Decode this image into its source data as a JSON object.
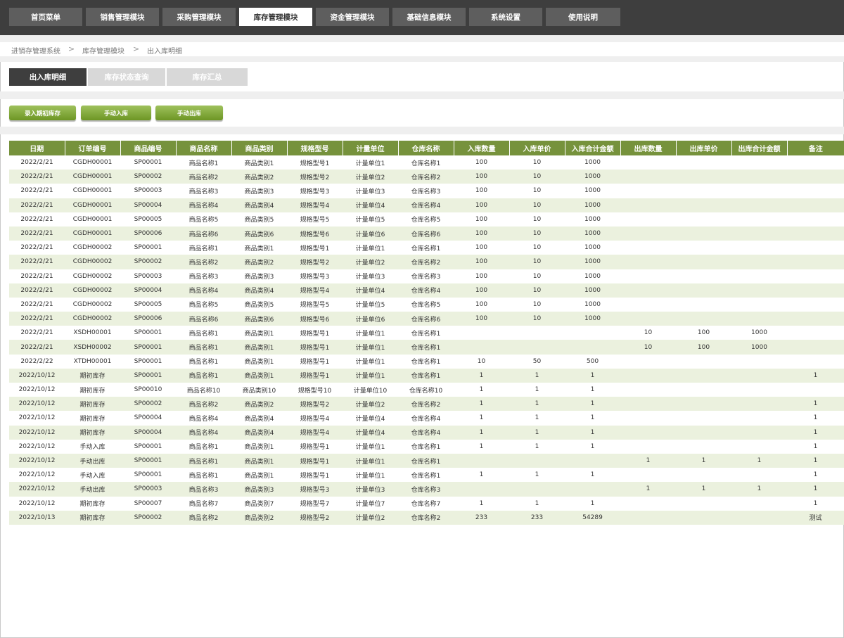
{
  "nav": {
    "tabs": [
      {
        "label": "首页菜单",
        "active": false
      },
      {
        "label": "销售管理模块",
        "active": false
      },
      {
        "label": "采购管理模块",
        "active": false
      },
      {
        "label": "库存管理模块",
        "active": true
      },
      {
        "label": "资金管理模块",
        "active": false
      },
      {
        "label": "基础信息模块",
        "active": false
      },
      {
        "label": "系统设置",
        "active": false
      },
      {
        "label": "使用说明",
        "active": false
      }
    ]
  },
  "breadcrumb": {
    "items": [
      "进销存管理系统",
      "库存管理模块",
      "出入库明细"
    ],
    "separator": ">"
  },
  "subtabs": [
    {
      "label": "出入库明细",
      "active": true
    },
    {
      "label": "库存状态查询",
      "active": false
    },
    {
      "label": "库存汇总",
      "active": false
    }
  ],
  "actions": [
    "录入期初库存",
    "手动入库",
    "手动出库"
  ],
  "colors": {
    "topbar": "#3e3e3e",
    "nav_tab": "#5e5e5e",
    "header_green": "#76923c",
    "row_alt": "#ebf1de",
    "button_green": "#7ca233"
  },
  "table": {
    "columns": [
      "日期",
      "订单编号",
      "商品编号",
      "商品名称",
      "商品类别",
      "规格型号",
      "计量单位",
      "仓库名称",
      "入库数量",
      "入库单价",
      "入库合计金额",
      "出库数量",
      "出库单价",
      "出库合计金额",
      "备注"
    ],
    "rows": [
      [
        "2022/2/21",
        "CGDH00001",
        "SP00001",
        "商品名称1",
        "商品类别1",
        "规格型号1",
        "计量单位1",
        "仓库名称1",
        "100",
        "10",
        "1000",
        "",
        "",
        "",
        ""
      ],
      [
        "2022/2/21",
        "CGDH00001",
        "SP00002",
        "商品名称2",
        "商品类别2",
        "规格型号2",
        "计量单位2",
        "仓库名称2",
        "100",
        "10",
        "1000",
        "",
        "",
        "",
        ""
      ],
      [
        "2022/2/21",
        "CGDH00001",
        "SP00003",
        "商品名称3",
        "商品类别3",
        "规格型号3",
        "计量单位3",
        "仓库名称3",
        "100",
        "10",
        "1000",
        "",
        "",
        "",
        ""
      ],
      [
        "2022/2/21",
        "CGDH00001",
        "SP00004",
        "商品名称4",
        "商品类别4",
        "规格型号4",
        "计量单位4",
        "仓库名称4",
        "100",
        "10",
        "1000",
        "",
        "",
        "",
        ""
      ],
      [
        "2022/2/21",
        "CGDH00001",
        "SP00005",
        "商品名称5",
        "商品类别5",
        "规格型号5",
        "计量单位5",
        "仓库名称5",
        "100",
        "10",
        "1000",
        "",
        "",
        "",
        ""
      ],
      [
        "2022/2/21",
        "CGDH00001",
        "SP00006",
        "商品名称6",
        "商品类别6",
        "规格型号6",
        "计量单位6",
        "仓库名称6",
        "100",
        "10",
        "1000",
        "",
        "",
        "",
        ""
      ],
      [
        "2022/2/21",
        "CGDH00002",
        "SP00001",
        "商品名称1",
        "商品类别1",
        "规格型号1",
        "计量单位1",
        "仓库名称1",
        "100",
        "10",
        "1000",
        "",
        "",
        "",
        ""
      ],
      [
        "2022/2/21",
        "CGDH00002",
        "SP00002",
        "商品名称2",
        "商品类别2",
        "规格型号2",
        "计量单位2",
        "仓库名称2",
        "100",
        "10",
        "1000",
        "",
        "",
        "",
        ""
      ],
      [
        "2022/2/21",
        "CGDH00002",
        "SP00003",
        "商品名称3",
        "商品类别3",
        "规格型号3",
        "计量单位3",
        "仓库名称3",
        "100",
        "10",
        "1000",
        "",
        "",
        "",
        ""
      ],
      [
        "2022/2/21",
        "CGDH00002",
        "SP00004",
        "商品名称4",
        "商品类别4",
        "规格型号4",
        "计量单位4",
        "仓库名称4",
        "100",
        "10",
        "1000",
        "",
        "",
        "",
        ""
      ],
      [
        "2022/2/21",
        "CGDH00002",
        "SP00005",
        "商品名称5",
        "商品类别5",
        "规格型号5",
        "计量单位5",
        "仓库名称5",
        "100",
        "10",
        "1000",
        "",
        "",
        "",
        ""
      ],
      [
        "2022/2/21",
        "CGDH00002",
        "SP00006",
        "商品名称6",
        "商品类别6",
        "规格型号6",
        "计量单位6",
        "仓库名称6",
        "100",
        "10",
        "1000",
        "",
        "",
        "",
        ""
      ],
      [
        "2022/2/21",
        "XSDH00001",
        "SP00001",
        "商品名称1",
        "商品类别1",
        "规格型号1",
        "计量单位1",
        "仓库名称1",
        "",
        "",
        "",
        "10",
        "100",
        "1000",
        ""
      ],
      [
        "2022/2/21",
        "XSDH00002",
        "SP00001",
        "商品名称1",
        "商品类别1",
        "规格型号1",
        "计量单位1",
        "仓库名称1",
        "",
        "",
        "",
        "10",
        "100",
        "1000",
        ""
      ],
      [
        "2022/2/22",
        "XTDH00001",
        "SP00001",
        "商品名称1",
        "商品类别1",
        "规格型号1",
        "计量单位1",
        "仓库名称1",
        "10",
        "50",
        "500",
        "",
        "",
        "",
        ""
      ],
      [
        "2022/10/12",
        "期初库存",
        "SP00001",
        "商品名称1",
        "商品类别1",
        "规格型号1",
        "计量单位1",
        "仓库名称1",
        "1",
        "1",
        "1",
        "",
        "",
        "",
        "1"
      ],
      [
        "2022/10/12",
        "期初库存",
        "SP00010",
        "商品名称10",
        "商品类别10",
        "规格型号10",
        "计量单位10",
        "仓库名称10",
        "1",
        "1",
        "1",
        "",
        "",
        "",
        ""
      ],
      [
        "2022/10/12",
        "期初库存",
        "SP00002",
        "商品名称2",
        "商品类别2",
        "规格型号2",
        "计量单位2",
        "仓库名称2",
        "1",
        "1",
        "1",
        "",
        "",
        "",
        "1"
      ],
      [
        "2022/10/12",
        "期初库存",
        "SP00004",
        "商品名称4",
        "商品类别4",
        "规格型号4",
        "计量单位4",
        "仓库名称4",
        "1",
        "1",
        "1",
        "",
        "",
        "",
        "1"
      ],
      [
        "2022/10/12",
        "期初库存",
        "SP00004",
        "商品名称4",
        "商品类别4",
        "规格型号4",
        "计量单位4",
        "仓库名称4",
        "1",
        "1",
        "1",
        "",
        "",
        "",
        "1"
      ],
      [
        "2022/10/12",
        "手动入库",
        "SP00001",
        "商品名称1",
        "商品类别1",
        "规格型号1",
        "计量单位1",
        "仓库名称1",
        "1",
        "1",
        "1",
        "",
        "",
        "",
        "1"
      ],
      [
        "2022/10/12",
        "手动出库",
        "SP00001",
        "商品名称1",
        "商品类别1",
        "规格型号1",
        "计量单位1",
        "仓库名称1",
        "",
        "",
        "",
        "1",
        "1",
        "1",
        "1"
      ],
      [
        "2022/10/12",
        "手动入库",
        "SP00001",
        "商品名称1",
        "商品类别1",
        "规格型号1",
        "计量单位1",
        "仓库名称1",
        "1",
        "1",
        "1",
        "",
        "",
        "",
        "1"
      ],
      [
        "2022/10/12",
        "手动出库",
        "SP00003",
        "商品名称3",
        "商品类别3",
        "规格型号3",
        "计量单位3",
        "仓库名称3",
        "",
        "",
        "",
        "1",
        "1",
        "1",
        "1"
      ],
      [
        "2022/10/12",
        "期初库存",
        "SP00007",
        "商品名称7",
        "商品类别7",
        "规格型号7",
        "计量单位7",
        "仓库名称7",
        "1",
        "1",
        "1",
        "",
        "",
        "",
        "1"
      ],
      [
        "2022/10/13",
        "期初库存",
        "SP00002",
        "商品名称2",
        "商品类别2",
        "规格型号2",
        "计量单位2",
        "仓库名称2",
        "233",
        "233",
        "54289",
        "",
        "",
        "",
        "测试"
      ]
    ]
  }
}
